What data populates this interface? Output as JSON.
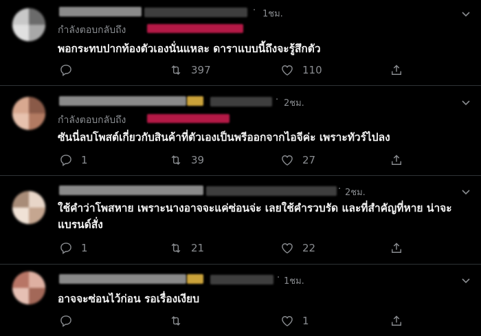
{
  "replying_label": "กำลังตอบกลับถึง",
  "tweets": [
    {
      "time": "1ชม.",
      "replying": true,
      "text": "พอกระทบปากท้องตัวเองนั่นแหละ ดาราแบบนี้ถึงจะรู้สึกตัว",
      "replies": "",
      "retweets": "397",
      "likes": "110"
    },
    {
      "time": "2ชม.",
      "replying": true,
      "text": "ซันนี่ลบโพสต์เกี่ยวกับสินค้าที่ตัวเองเป็นพรีออกจากไอจีค่ะ เพราะทัวร์ไปลง",
      "replies": "1",
      "retweets": "39",
      "likes": "27"
    },
    {
      "time": "2ชม.",
      "replying": false,
      "text": "ใช้คำว่าโพสหาย เพราะนางอาจจะแค่ซ่อนจ่ะ เลยใช้คำรวบรัด และที่สำคัญที่หาย น่าจะแบรนด์สั่ง",
      "replies": "1",
      "retweets": "21",
      "likes": "22"
    },
    {
      "time": "1ชม.",
      "replying": false,
      "text": "อาจจะซ่อนไว้ก่อน รอเรื่องเงียบ",
      "replies": "",
      "retweets": "",
      "likes": "1"
    }
  ],
  "icons": {
    "reply": "reply-icon",
    "retweet": "retweet-icon",
    "like": "heart-icon",
    "share": "share-icon",
    "more": "chevron-down-icon"
  },
  "colors": {
    "background": "#000000",
    "text": "#f2f2f2",
    "muted": "#8a8d91",
    "mention": "#e0245e"
  }
}
